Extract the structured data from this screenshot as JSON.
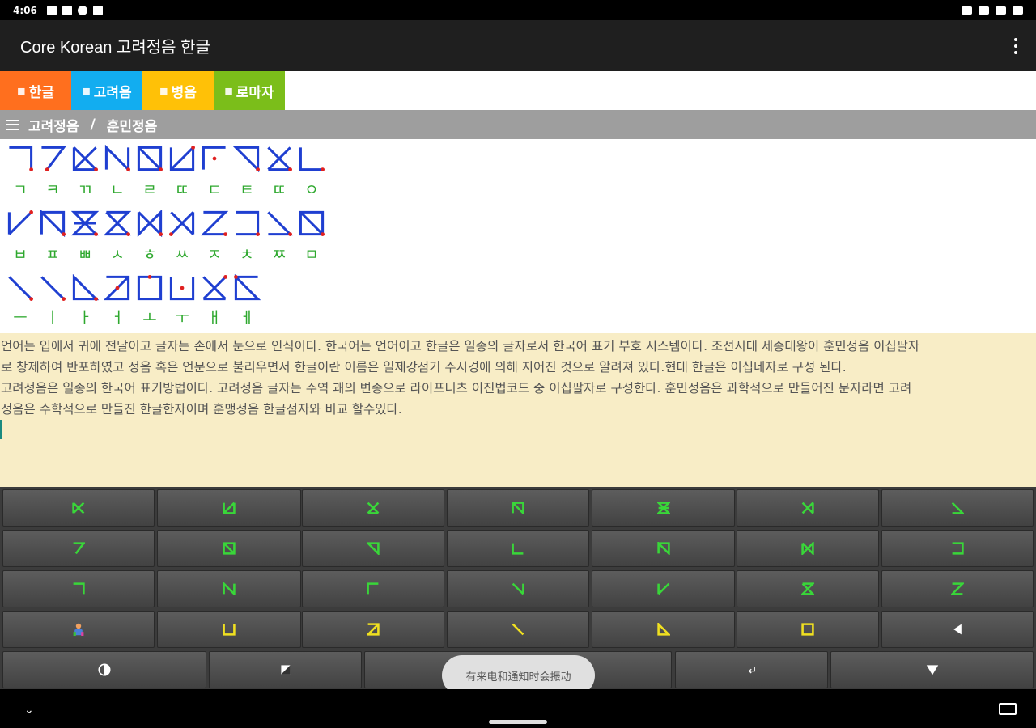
{
  "status_bar": {
    "time": "4:06",
    "left_icons": [
      "notification-icon",
      "grid-icon",
      "settings-icon",
      "p-icon"
    ],
    "right_icons": [
      "key-icon",
      "mute-icon",
      "wifi-icon",
      "battery-icon"
    ]
  },
  "app_bar": {
    "title": "Core Korean 고려정음 한글",
    "menu_icon": "overflow-menu-icon"
  },
  "tabs": [
    {
      "label": "한글",
      "color": "#ff6f1e"
    },
    {
      "label": "고려음",
      "color": "#12adf0"
    },
    {
      "label": "병음",
      "color": "#ffc107"
    },
    {
      "label": "로마자",
      "color": "#7bbe1a"
    }
  ],
  "breadcrumb": {
    "part1": "고려정음",
    "separator": "/",
    "part2": "훈민정음"
  },
  "chart": {
    "rows": [
      {
        "jamo": [
          "ㄱ",
          "ㅋ",
          "ㄲ",
          "ㄴ",
          "ㄹ",
          "ㄸ",
          "ㄷ",
          "ㅌ",
          "ㄸ",
          "ㅇ"
        ]
      },
      {
        "jamo": [
          "ㅂ",
          "ㅍ",
          "ㅃ",
          "ㅅ",
          "ㅎ",
          "ㅆ",
          "ㅈ",
          "ㅊ",
          "ㅉ",
          "ㅁ"
        ]
      },
      {
        "jamo": [
          "ㅡ",
          "ㅣ",
          "ㅏ",
          "ㅓ",
          "ㅗ",
          "ㅜ",
          "ㅐ",
          "ㅔ"
        ]
      }
    ],
    "glyph_color": "#1f3fd1",
    "dot_color": "#e02020",
    "jamo_color": "#2ea82e"
  },
  "text": {
    "lines": [
      "언어는 입에서 귀에 전달이고 글자는 손에서 눈으로 인식이다. 한국어는 언어이고 한글은 일종의 글자로서 한국어 표기 부호 시스템이다. 조선시대 세종대왕이 훈민정음 이십팔자",
      "로 창제하여 반포하였고 정음 혹은 언문으로 불리우면서 한글이란 이름은 일제강점기 주시경에 의해 지어진 것으로 알려져 있다.현대 한글은 이십네자로 구성 된다.",
      " 고려정음은 일종의 한국어 표기방법이다. 고려정음 글자는 주역 괘의 변종으로 라이프니츠 이진법코드 중 이십팔자로 구성한다. 훈민정음은 과학적으로 만들어진 문자라면 고려",
      "정음은 수학적으로 만들진 한글한자이며 훈맹정음 한글점자와 비교 할수있다."
    ]
  },
  "keyboard": {
    "key_color_green": "#39d639",
    "key_color_yellow": "#f0e020"
  },
  "toast": {
    "text": "有来电和通知时会振动"
  },
  "nav_bar": {
    "back_icon": "chevron-down-icon",
    "home_icon": "home-pill-icon",
    "keyboard_icon": "keyboard-icon"
  }
}
